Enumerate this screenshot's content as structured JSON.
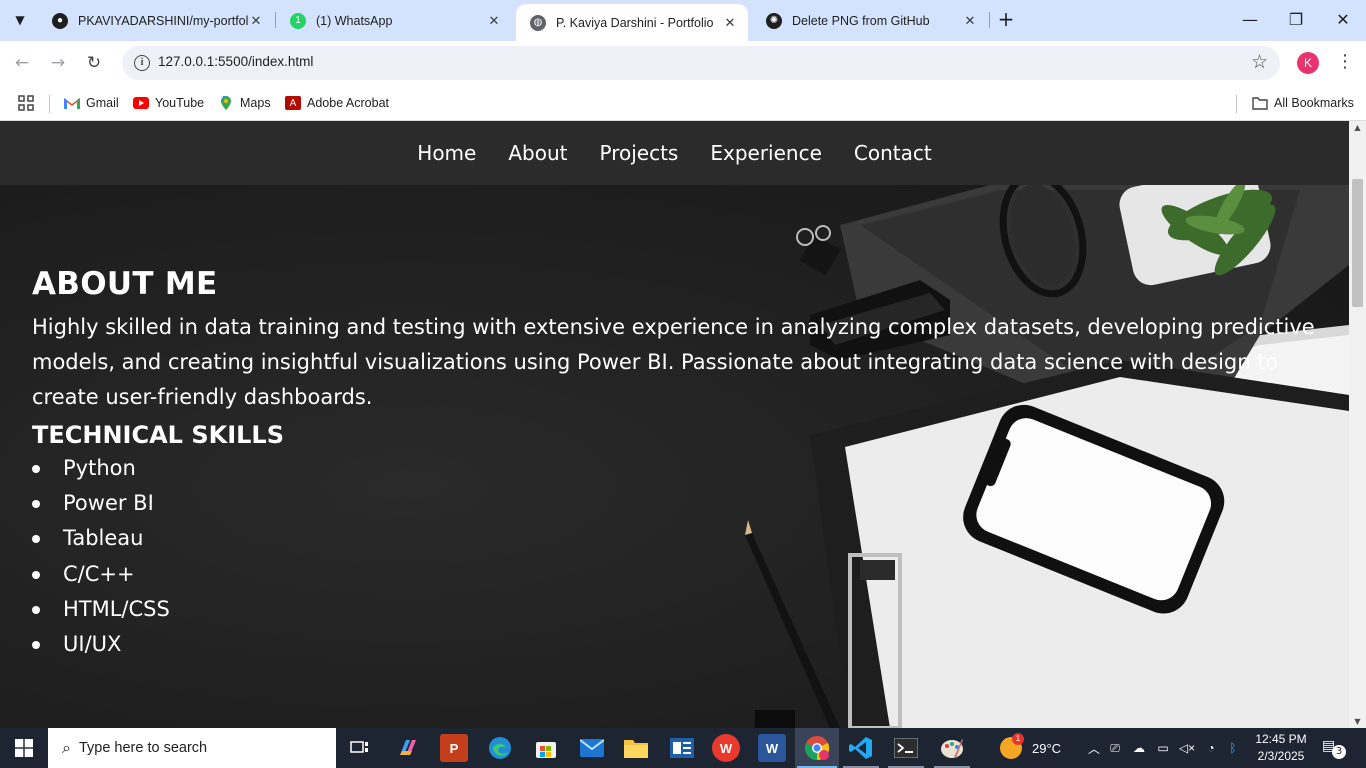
{
  "browser": {
    "tabs": [
      {
        "title": "PKAVIYADARSHINI/my-portfolio",
        "icon": "github-icon"
      },
      {
        "title": "(1) WhatsApp",
        "icon": "whatsapp-icon"
      },
      {
        "title": "P. Kaviya Darshini - Portfolio",
        "icon": "globe-icon",
        "active": true
      },
      {
        "title": "Delete PNG from GitHub",
        "icon": "chatgpt-icon"
      }
    ],
    "url": "127.0.0.1:5500/index.html",
    "profile_initial": "K",
    "bookmarks": [
      "Gmail",
      "YouTube",
      "Maps",
      "Adobe Acrobat"
    ],
    "all_bookmarks": "All Bookmarks"
  },
  "site": {
    "nav": [
      "Home",
      "About",
      "Projects",
      "Experience",
      "Contact"
    ],
    "about_heading": "ABOUT ME",
    "about_text": "Highly skilled in data training and testing with extensive experience in analyzing complex datasets, developing predictive models, and creating insightful visualizations using Power BI. Passionate about integrating data science with design to create user-friendly dashboards.",
    "skills_heading": "TECHNICAL SKILLS",
    "skills": [
      "Python",
      "Power BI",
      "Tableau",
      "C/C++",
      "HTML/CSS",
      "UI/UX"
    ]
  },
  "taskbar": {
    "search_placeholder": "Type here to search",
    "weather": "29°C",
    "weather_badge": "1",
    "time": "12:45 PM",
    "date": "2/3/2025",
    "notification_count": "3"
  },
  "colors": {
    "tabstrip": "#d3e3fd",
    "site_nav": "#2b2b2b",
    "taskbar": "#1d2533",
    "profile": "#e8336f"
  }
}
